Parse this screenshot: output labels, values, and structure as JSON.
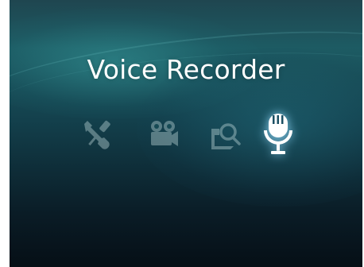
{
  "screen": {
    "title": "Voice Recorder"
  },
  "menu": {
    "items": [
      {
        "name": "settings",
        "icon": "wrench-screwdriver-icon",
        "active": false
      },
      {
        "name": "video",
        "icon": "video-camera-icon",
        "active": false
      },
      {
        "name": "browse",
        "icon": "image-search-icon",
        "active": false
      },
      {
        "name": "voice-recorder",
        "icon": "microphone-icon",
        "active": true
      }
    ]
  },
  "colors": {
    "active_icon": "#ffffff",
    "active_glow": "#96dcff",
    "dim_icon": "#7fa6a8",
    "background_top": "#1d5b63",
    "background_bottom": "#060f16"
  }
}
